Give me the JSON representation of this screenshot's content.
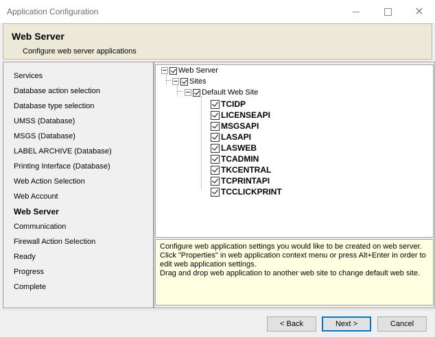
{
  "window": {
    "title": "Application Configuration"
  },
  "header": {
    "title": "Web Server",
    "subtitle": "Configure web server applications"
  },
  "nav": {
    "items": [
      {
        "label": "Services"
      },
      {
        "label": "Database action selection"
      },
      {
        "label": "Database type selection"
      },
      {
        "label": "UMSS (Database)"
      },
      {
        "label": "MSGS (Database)"
      },
      {
        "label": "LABEL ARCHIVE (Database)"
      },
      {
        "label": "Printing Interface (Database)"
      },
      {
        "label": "Web Action Selection"
      },
      {
        "label": "Web Account"
      },
      {
        "label": "Web Server",
        "active": true
      },
      {
        "label": "Communication"
      },
      {
        "label": "Firewall Action Selection"
      },
      {
        "label": "Ready"
      },
      {
        "label": "Progress"
      },
      {
        "label": "Complete"
      }
    ]
  },
  "tree": {
    "root": "Web Server",
    "sites": "Sites",
    "site": "Default Web Site",
    "apps": [
      "TCIDP",
      "LICENSEAPI",
      "MSGSAPI",
      "LASAPI",
      "LASWEB",
      "TCADMIN",
      "TKCENTRAL",
      "TCPRINTAPI",
      "TCCLICKPRINT"
    ]
  },
  "info": {
    "line1": "Configure web application settings you would like to be created on web server.",
    "line2": "Click \"Properties\" in web application context menu or press Alt+Enter in order to edit web application settings.",
    "line3": "Drag and drop web application to another web site to change default web site."
  },
  "buttons": {
    "back": "< Back",
    "next": "Next >",
    "cancel": "Cancel"
  },
  "icons": {
    "minimize": "minimize-icon",
    "maximize": "maximize-icon",
    "close": "close-icon"
  },
  "colors": {
    "header_bg": "#ece9d8",
    "info_bg": "#ffffe1",
    "default_button_border": "#0078d7"
  }
}
